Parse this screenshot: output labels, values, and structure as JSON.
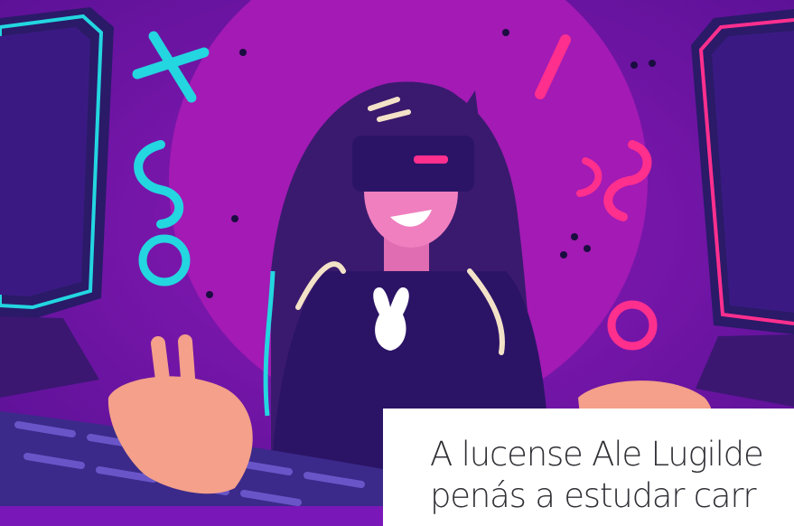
{
  "article": {
    "image": {
      "subject": "vr-gamer-girl-illustration",
      "palette": {
        "background": "#7a17b8",
        "glow": "#a31ab4",
        "cyan": "#23d6e0",
        "pink": "#ff2f8e",
        "hair": "#3a1a6e",
        "skin": "#f07fbf"
      }
    },
    "headline": {
      "line1": "A lucense Ale Lugilde",
      "line2": "penás a estudar carr"
    }
  }
}
